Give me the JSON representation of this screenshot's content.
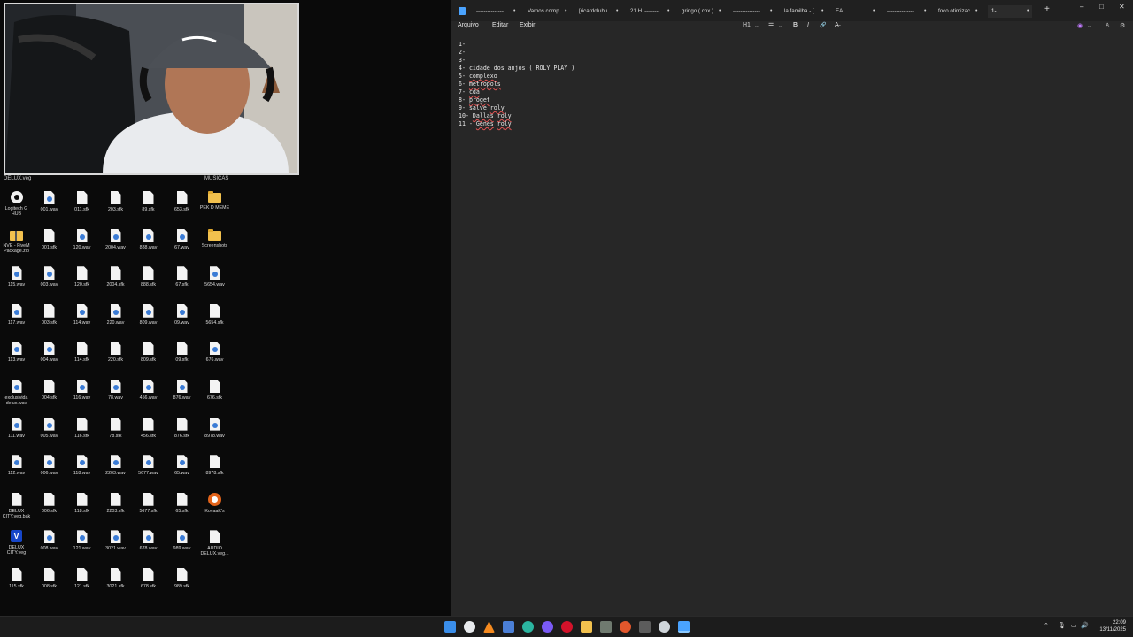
{
  "desktop": {
    "left_label": "DELUX.veg",
    "right_label": "MUSICAS",
    "columns": [
      [
        "Logitech G HUB",
        "NVE - FiveM Package.zip",
        "115.wav",
        "117.wav",
        "113.wav",
        "exclusivida delux.wav",
        "111.wav",
        "112.wav",
        "DELUX CITY.veg.bak",
        "DELUX CITY.veg",
        "115.sfk"
      ],
      [
        "001.wav",
        "001.sfk",
        "003.wav",
        "003.sfk",
        "004.wav",
        "004.sfk",
        "005.wav",
        "006.wav",
        "006.sfk",
        "008.wav",
        "008.sfk"
      ],
      [
        "011.sfk",
        "120.wav",
        "120.sfk",
        "114.wav",
        "114.sfk",
        "116.wav",
        "116.sfk",
        "118.wav",
        "118.sfk",
        "121.wav",
        "121.sfk"
      ],
      [
        "203.sfk",
        "2004.wav",
        "2004.sfk",
        "220.wav",
        "220.sfk",
        "78.wav",
        "78.sfk",
        "2203.wav",
        "2203.sfk",
        "3021.wav",
        "3021.sfk"
      ],
      [
        "89.sfk",
        "888.wav",
        "888.sfk",
        "809.wav",
        "809.sfk",
        "456.wav",
        "456.sfk",
        "5677.wav",
        "5677.sfk",
        "678.wav",
        "678.sfk"
      ],
      [
        "653.sfk",
        "67.wav",
        "67.sfk",
        "09.wav",
        "09.sfk",
        "876.wav",
        "876.sfk",
        "65.wav",
        "65.sfk",
        "989.wav",
        "989.sfk"
      ],
      [
        "PEK D MEME",
        "Screenshots",
        "5654.wav",
        "5654.sfk",
        "676.wav",
        "676.sfk",
        "8978.wav",
        "8978.sfk",
        "KovaaK's",
        "AUDIO DELUX.veg..."
      ]
    ]
  },
  "notepad": {
    "tabs": [
      "---------------",
      "Vamos comp",
      "[ricardolubu",
      "21 H ---------",
      "gringo ( cpx )",
      "---------------",
      "la familha - [",
      "EA",
      "---------------",
      "foco otimizac",
      "1-"
    ],
    "menu": [
      "Arquivo",
      "Editar",
      "Exibir"
    ],
    "toolbar": {
      "heading": "H1",
      "list": "☰",
      "bold": "B",
      "italic": "I",
      "link": "🔗",
      "clear": "A̶"
    },
    "lines": [
      "1-",
      "2-",
      "3-",
      "4- cidade dos anjos ( ROLY PLAY )",
      "5- complexo",
      "6- metropols",
      "7- cda",
      "8- proget",
      "9- salve roly",
      "10- Dallas roly",
      "11 - Genes roly"
    ],
    "misspelled": [
      "complexo",
      "metropols",
      "cda",
      "proget",
      "roly",
      "Dallas",
      "Genes"
    ]
  },
  "taskbar": {
    "time": "22:09",
    "date": "13/11/2025",
    "icons": [
      "windows-start",
      "chrome",
      "vlc",
      "calendar",
      "edge",
      "discord",
      "opera",
      "file-explorer",
      "app-7",
      "app-8",
      "xbox",
      "steam",
      "notepad"
    ]
  }
}
